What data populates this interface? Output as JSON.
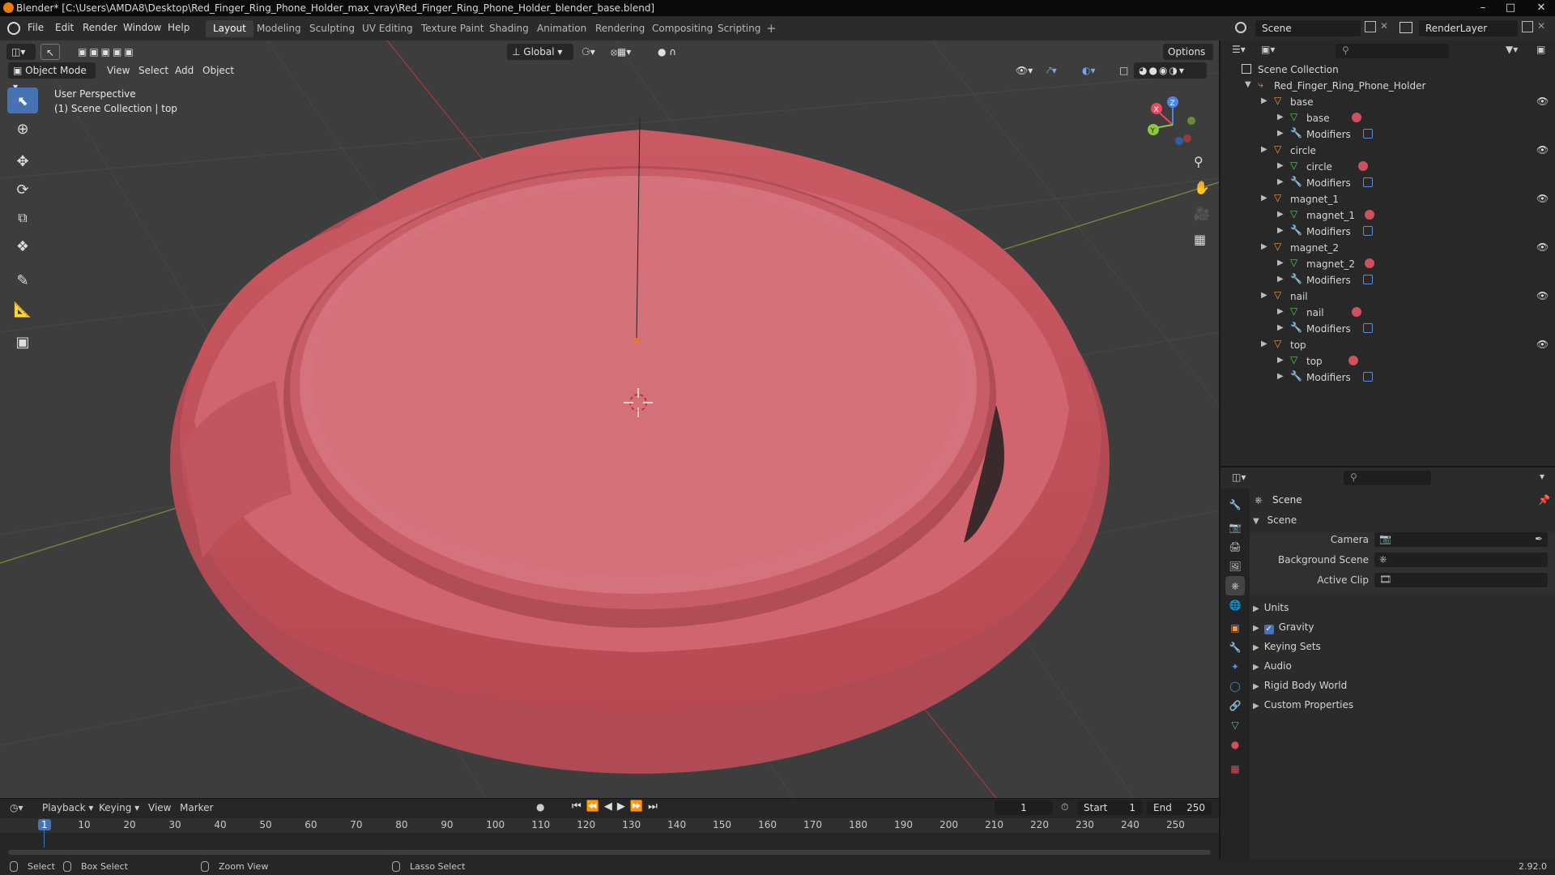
{
  "title_bar": {
    "text": "Blender* [C:\\Users\\AMDA8\\Desktop\\Red_Finger_Ring_Phone_Holder_max_vray\\Red_Finger_Ring_Phone_Holder_blender_base.blend]"
  },
  "menu": [
    "File",
    "Edit",
    "Render",
    "Window",
    "Help"
  ],
  "workspaces": [
    "Layout",
    "Modeling",
    "Sculpting",
    "UV Editing",
    "Texture Paint",
    "Shading",
    "Animation",
    "Rendering",
    "Compositing",
    "Scripting"
  ],
  "scene_field": "Scene",
  "view_layer_field": "RenderLayer",
  "viewport": {
    "transform_orientation": "Global",
    "options_label": "Options",
    "mode": "Object Mode",
    "header_menu": [
      "View",
      "Select",
      "Add",
      "Object"
    ],
    "overlay_line1": "User Perspective",
    "overlay_line2": "(1) Scene Collection | top",
    "gizmo": {
      "x": "X",
      "y": "Y",
      "z": "Z"
    },
    "model_color": "#d9707a"
  },
  "outliner": {
    "root": "Scene Collection",
    "collection": "Red_Finger_Ring_Phone_Holder",
    "objects": [
      {
        "name": "base",
        "mesh": "base",
        "modifiers": "Modifiers"
      },
      {
        "name": "circle",
        "mesh": "circle",
        "modifiers": "Modifiers"
      },
      {
        "name": "magnet_1",
        "mesh": "magnet_1",
        "modifiers": "Modifiers"
      },
      {
        "name": "magnet_2",
        "mesh": "magnet_2",
        "modifiers": "Modifiers"
      },
      {
        "name": "nail",
        "mesh": "nail",
        "modifiers": "Modifiers"
      },
      {
        "name": "top",
        "mesh": "top",
        "modifiers": "Modifiers"
      }
    ]
  },
  "properties": {
    "header": "Scene",
    "panel": "Scene",
    "camera_label": "Camera",
    "background_scene_label": "Background Scene",
    "active_clip_label": "Active Clip",
    "sections": [
      "Units",
      "Gravity",
      "Keying Sets",
      "Audio",
      "Rigid Body World",
      "Custom Properties"
    ],
    "gravity_checked": true
  },
  "timeline": {
    "menus": [
      "Playback",
      "Keying",
      "View",
      "Marker"
    ],
    "current_frame": "1",
    "start_label": "Start",
    "start": "1",
    "end_label": "End",
    "end": "250",
    "ticks": [
      "1",
      "10",
      "20",
      "30",
      "40",
      "50",
      "60",
      "70",
      "80",
      "90",
      "100",
      "110",
      "120",
      "130",
      "140",
      "150",
      "160",
      "170",
      "180",
      "190",
      "200",
      "210",
      "220",
      "230",
      "240",
      "250"
    ]
  },
  "status_bar": {
    "select": "Select",
    "box_select": "Box Select",
    "zoom_view": "Zoom View",
    "lasso_select": "Lasso Select",
    "version": "2.92.0"
  },
  "colors": {
    "accent": "#4772b3",
    "object_orange": "#e89b4c",
    "mesh_green": "#63c26b"
  }
}
